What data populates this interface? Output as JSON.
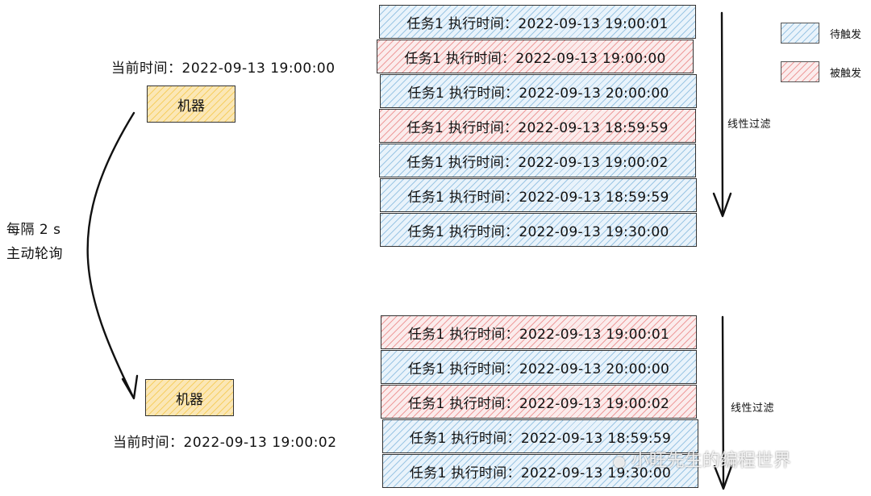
{
  "top": {
    "current_time": "当前时间：2022-09-13 19:00:00",
    "machine": "机器",
    "filter_label": "线性过滤",
    "tasks": [
      {
        "text": "任务1 执行时间：2022-09-13 19:00:01",
        "state": "pending"
      },
      {
        "text": "任务1 执行时间：2022-09-13 19:00:00",
        "state": "fired"
      },
      {
        "text": "任务1 执行时间：2022-09-13 20:00:00",
        "state": "pending"
      },
      {
        "text": "任务1 执行时间：2022-09-13 18:59:59",
        "state": "fired"
      },
      {
        "text": "任务1 执行时间：2022-09-13 19:00:02",
        "state": "pending"
      },
      {
        "text": "任务1 执行时间：2022-09-13 18:59:59",
        "state": "pending"
      },
      {
        "text": "任务1 执行时间：2022-09-13 19:30:00",
        "state": "pending"
      }
    ]
  },
  "bottom": {
    "current_time": "当前时间：2022-09-13 19:00:02",
    "machine": "机器",
    "filter_label": "线性过滤",
    "tasks": [
      {
        "text": "任务1 执行时间：2022-09-13 19:00:01",
        "state": "fired"
      },
      {
        "text": "任务1 执行时间：2022-09-13 20:00:00",
        "state": "pending"
      },
      {
        "text": "任务1 执行时间：2022-09-13 19:00:02",
        "state": "fired"
      },
      {
        "text": "任务1 执行时间：2022-09-13 18:59:59",
        "state": "pending"
      },
      {
        "text": "任务1 执行时间：2022-09-13 19:30:00",
        "state": "pending"
      }
    ]
  },
  "poll": {
    "line1": "每隔 2 s",
    "line2": "主动轮询"
  },
  "legend": {
    "pending_label": "待触发",
    "fired_label": "被触发",
    "pending_color": "#9cc6e4",
    "fired_color": "#ee9c9c"
  },
  "watermark": "小旺先生的编程世界"
}
